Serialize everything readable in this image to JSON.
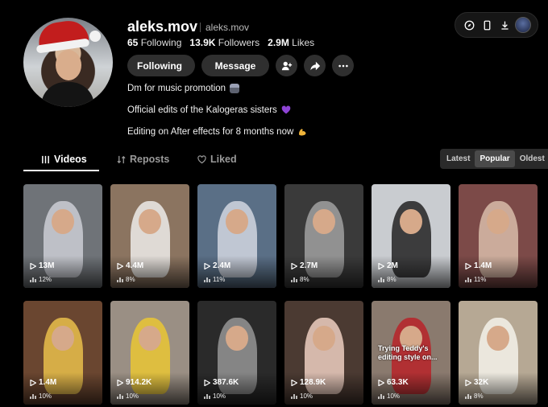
{
  "profile": {
    "username": "aleks.mov",
    "nickname": "aleks.mov",
    "stats": [
      {
        "value": "65",
        "label": "Following"
      },
      {
        "value": "13.9K",
        "label": "Followers"
      },
      {
        "value": "2.9M",
        "label": "Likes"
      }
    ],
    "buttons": {
      "following": "Following",
      "message": "Message"
    },
    "bio": [
      "Dm for music promotion",
      "Official edits of the Kalogeras sisters",
      "Editing on After effects for 8 months now"
    ]
  },
  "tabs": [
    {
      "label": "Videos",
      "active": true
    },
    {
      "label": "Reposts",
      "active": false
    },
    {
      "label": "Liked",
      "active": false
    }
  ],
  "sort": [
    {
      "label": "Latest",
      "active": false
    },
    {
      "label": "Popular",
      "active": true
    },
    {
      "label": "Oldest",
      "active": false
    }
  ],
  "videos": [
    {
      "views": "13M",
      "pct": "12%",
      "bg": "#6f7378",
      "fig": "#c7c9cf",
      "text": ""
    },
    {
      "views": "4.4M",
      "pct": "8%",
      "bg": "#8b7460",
      "fig": "#e8e6e2",
      "text": ""
    },
    {
      "views": "2.4M",
      "pct": "11%",
      "bg": "#5a6f86",
      "fig": "#cbd0dc",
      "text": ""
    },
    {
      "views": "2.7M",
      "pct": "8%",
      "bg": "#3a3a3a",
      "fig": "#9b9b9b",
      "text": ""
    },
    {
      "views": "2M",
      "pct": "8%",
      "bg": "#c9ccd0",
      "fig": "#2c2c2c",
      "text": ""
    },
    {
      "views": "1.4M",
      "pct": "11%",
      "bg": "#7c4a48",
      "fig": "#d4b6a4",
      "text": ""
    },
    {
      "views": "1.4M",
      "pct": "10%",
      "bg": "#6a4630",
      "fig": "#e2b84a",
      "text": ""
    },
    {
      "views": "914.2K",
      "pct": "10%",
      "bg": "#9a8f84",
      "fig": "#e6c339",
      "text": ""
    },
    {
      "views": "387.6K",
      "pct": "10%",
      "bg": "#2a2a2a",
      "fig": "#8f8f8f",
      "text": ""
    },
    {
      "views": "128.9K",
      "pct": "10%",
      "bg": "#4b3a32",
      "fig": "#e4c6b8",
      "text": ""
    },
    {
      "views": "63.3K",
      "pct": "10%",
      "bg": "#8a7a6e",
      "fig": "#b5282c",
      "text": "Trying Teddy's editing style on..."
    },
    {
      "views": "32K",
      "pct": "8%",
      "bg": "#b6a894",
      "fig": "#f1ede4",
      "text": ""
    }
  ]
}
